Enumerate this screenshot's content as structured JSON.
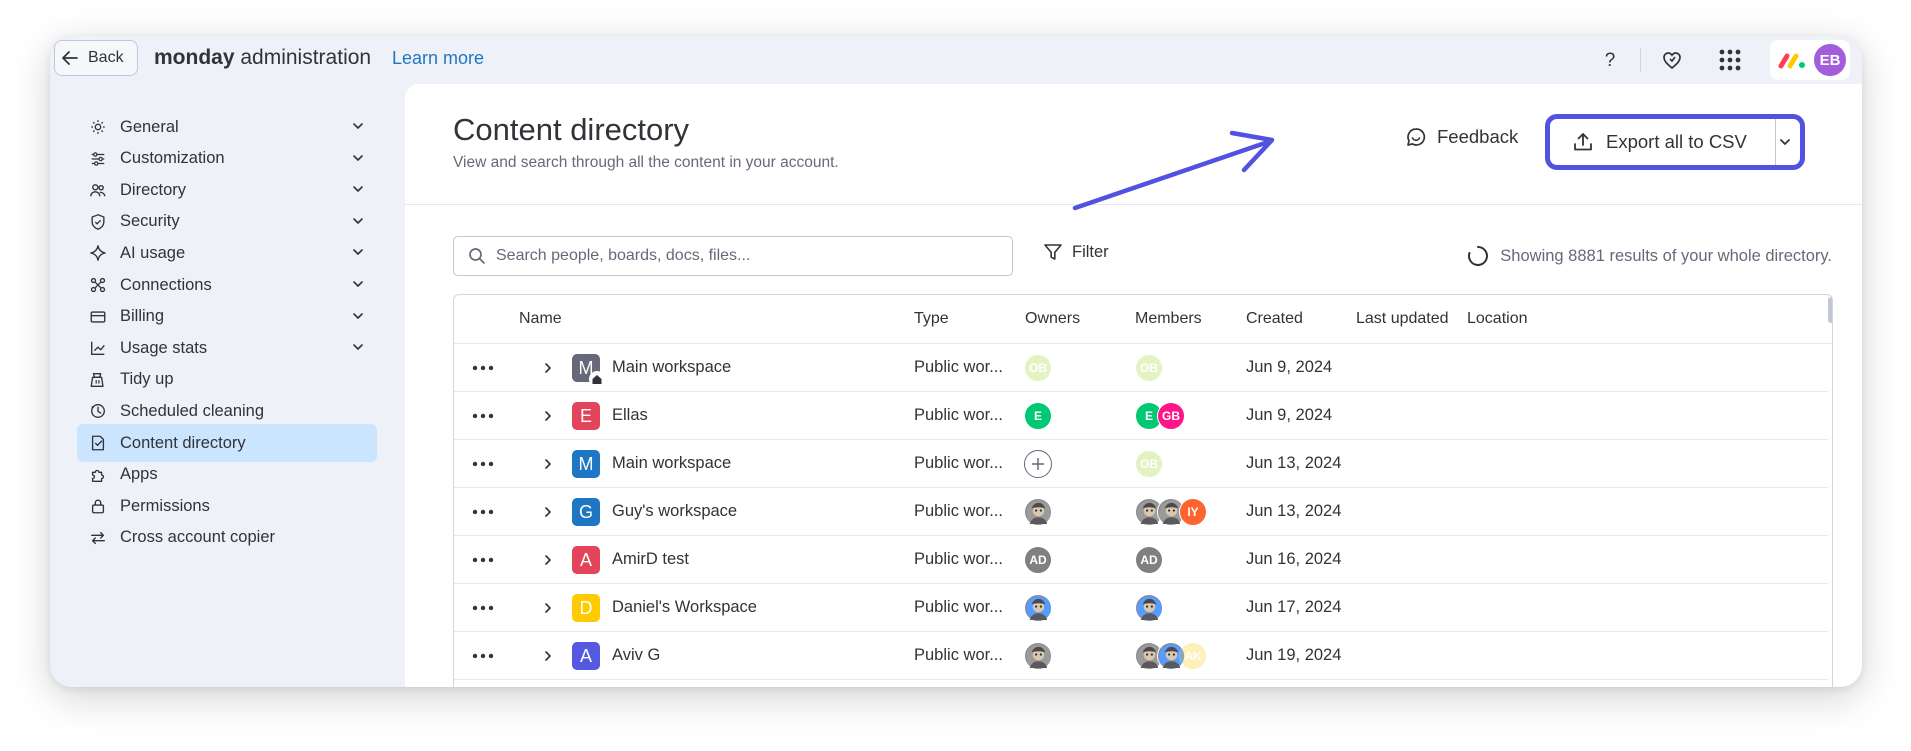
{
  "topbar": {
    "back_label": "Back",
    "brand_bold": "monday",
    "brand_rest": "administration",
    "learn_more": "Learn more",
    "user_initials": "EB"
  },
  "sidebar": {
    "items": [
      {
        "label": "General",
        "icon": "gear-icon",
        "expandable": true
      },
      {
        "label": "Customization",
        "icon": "sliders-icon",
        "expandable": true
      },
      {
        "label": "Directory",
        "icon": "people-icon",
        "expandable": true
      },
      {
        "label": "Security",
        "icon": "shield-icon",
        "expandable": true
      },
      {
        "label": "AI usage",
        "icon": "sparkle-icon",
        "expandable": true
      },
      {
        "label": "Connections",
        "icon": "connections-icon",
        "expandable": true
      },
      {
        "label": "Billing",
        "icon": "card-icon",
        "expandable": true
      },
      {
        "label": "Usage stats",
        "icon": "chart-icon",
        "expandable": true
      },
      {
        "label": "Tidy up",
        "icon": "broom-icon",
        "expandable": false
      },
      {
        "label": "Scheduled cleaning",
        "icon": "clock-icon",
        "expandable": false
      },
      {
        "label": "Content directory",
        "icon": "doc-icon",
        "expandable": false,
        "active": true
      },
      {
        "label": "Apps",
        "icon": "puzzle-icon",
        "expandable": false
      },
      {
        "label": "Permissions",
        "icon": "lock-icon",
        "expandable": false
      },
      {
        "label": "Cross account copier",
        "icon": "transfer-icon",
        "expandable": false
      }
    ]
  },
  "main": {
    "title": "Content directory",
    "subtitle": "View and search through all the content in your account.",
    "feedback_label": "Feedback",
    "export_label": "Export all to CSV",
    "search_placeholder": "Search people, boards, docs, files...",
    "filter_label": "Filter",
    "results_text": "Showing 8881 results of your whole directory."
  },
  "table": {
    "columns": [
      "Name",
      "Type",
      "Owners",
      "Members",
      "Created",
      "Last updated",
      "Location"
    ],
    "rows": [
      {
        "name": "Main workspace",
        "letter": "M",
        "color": "#676879",
        "home": true,
        "type": "Public wor...",
        "created": "Jun 9, 2024",
        "owners": [
          {
            "initials": "OB",
            "color": "#9cd326",
            "faded": true
          }
        ],
        "members": [
          {
            "initials": "OB",
            "color": "#9cd326",
            "faded": true
          }
        ]
      },
      {
        "name": "Ellas",
        "letter": "E",
        "color": "#e2445c",
        "type": "Public wor...",
        "created": "Jun 9, 2024",
        "owners": [
          {
            "initials": "E",
            "color": "#00c875"
          }
        ],
        "members": [
          {
            "initials": "E",
            "color": "#00c875"
          },
          {
            "initials": "GB",
            "color": "#ff158a"
          }
        ]
      },
      {
        "name": "Main workspace",
        "letter": "M",
        "color": "#1f76c2",
        "type": "Public wor...",
        "created": "Jun 13, 2024",
        "owners": [
          {
            "add": true
          }
        ],
        "members": [
          {
            "initials": "OB",
            "color": "#9cd326",
            "faded": true
          }
        ]
      },
      {
        "name": "Guy's workspace",
        "letter": "G",
        "color": "#1f76c2",
        "type": "Public wor...",
        "created": "Jun 13, 2024",
        "owners": [
          {
            "initials": "",
            "photo": true
          }
        ],
        "members": [
          {
            "initials": "",
            "photo": true
          },
          {
            "initials": "",
            "photo": true
          },
          {
            "initials": "IY",
            "color": "#ff642e"
          }
        ]
      },
      {
        "name": "AmirD test",
        "letter": "A",
        "color": "#e2445c",
        "type": "Public wor...",
        "created": "Jun 16, 2024",
        "owners": [
          {
            "initials": "AD",
            "color": "#808080"
          }
        ],
        "members": [
          {
            "initials": "AD",
            "color": "#808080"
          }
        ]
      },
      {
        "name": "Daniel's Workspace",
        "letter": "D",
        "color": "#ffcb00",
        "type": "Public wor...",
        "created": "Jun 17, 2024",
        "owners": [
          {
            "initials": "",
            "photo": true,
            "tint": "#579bfc"
          }
        ],
        "members": [
          {
            "initials": "",
            "photo": true,
            "tint": "#579bfc"
          }
        ]
      },
      {
        "name": "Aviv G",
        "letter": "A",
        "color": "#5559df",
        "type": "Public wor...",
        "created": "Jun 19, 2024",
        "owners": [
          {
            "initials": "",
            "photo": true
          }
        ],
        "members": [
          {
            "initials": "",
            "photo": true
          },
          {
            "initials": "",
            "photo": true,
            "tint": "#579bfc"
          },
          {
            "initials": "AK",
            "color": "#ffcb00",
            "faded": true
          }
        ]
      }
    ]
  },
  "colors": {
    "accent": "#5252e0",
    "link": "#1f76c2",
    "active_nav": "#cce5ff"
  }
}
